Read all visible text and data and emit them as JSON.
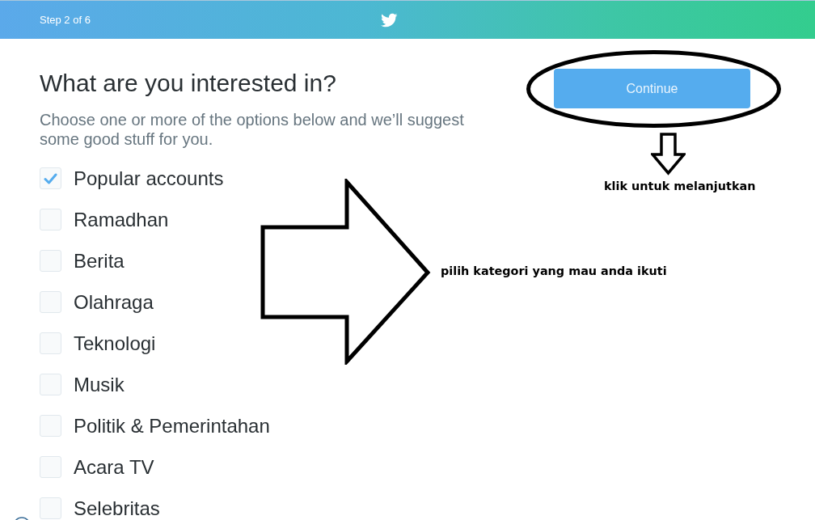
{
  "header": {
    "step": "Step 2 of 6"
  },
  "heading": "What are you interested in?",
  "description": "Choose one or more of the options below and we’ll suggest some good stuff for you.",
  "options": [
    {
      "label": "Popular accounts",
      "checked": true
    },
    {
      "label": "Ramadhan",
      "checked": false
    },
    {
      "label": "Berita",
      "checked": false
    },
    {
      "label": "Olahraga",
      "checked": false
    },
    {
      "label": "Teknologi",
      "checked": false
    },
    {
      "label": "Musik",
      "checked": false
    },
    {
      "label": "Politik & Pemerintahan",
      "checked": false
    },
    {
      "label": "Acara TV",
      "checked": false
    },
    {
      "label": "Selebritas",
      "checked": false
    }
  ],
  "continue_button": {
    "label": "Continue",
    "circled": true
  },
  "annotations": [
    {
      "kind": "down-arrow",
      "text": "klik untuk melanjutkan"
    },
    {
      "kind": "right-arrow",
      "text": "pilih kategori yang mau anda ikuti"
    }
  ]
}
